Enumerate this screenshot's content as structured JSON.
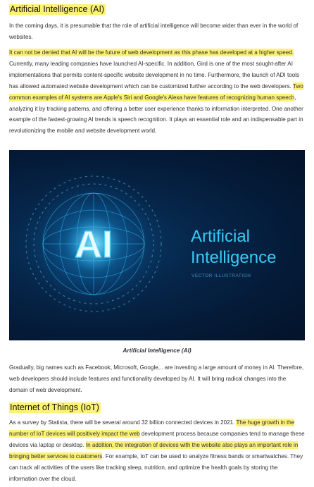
{
  "section1": {
    "heading": "Artificial Intelligence (AI)",
    "p1": "In the coming days, it is presumable that the role of artificial intelligence will become wider than ever in the world of websites.",
    "p2": {
      "h1": "It can not be denied that AI will be the future of web development as this phase has developed at a higher speed.",
      "t1": " Currently, many leading companies have launched AI-specific. In addition, Gird is one of the most sought-after AI implementations that permits content-specific website development in no time. Furthermore, the launch of ADI tools has allowed automated website development which can be customized further according to the web developers. ",
      "h2": "Two common examples of AI systems are Apple's Siri and Google's Alexa have features of recognizing human speech",
      "t2": ", analyzing it by tracking patterns, and offering a better user experience thanks to information interpreted. One another example of the fastest-growing AI trends is speech recognition. It plays an essential role and an indispensable part in revolutionizing the mobile and website development world."
    }
  },
  "image": {
    "mark": "AI",
    "title_line1": "Artificial",
    "title_line2": "Intelligence",
    "subtitle": "VECTOR ILLUSTRATION",
    "caption": "Artificial Intelligence (AI)"
  },
  "p3": "Gradually, big names such as Facebook, Microsoft, Google,.. are investing a large amount of money in AI. Therefore, web developers should include features and functionality developed by AI. It will bring radical changes into the domain of web development.",
  "section2": {
    "heading": "Internet of Things (IoT)",
    "p": {
      "t1": "As a survey by Statista, there will be several around 32 billion connected devices in 2021. ",
      "h1": "The huge growth in the number of IoT devices will positively impact the web",
      "t2": " development process because companies tend to manage these devices via laptop or desktop. ",
      "h2": "In addition, the integration of devices with the website also plays an important role in bringing better services to customers",
      "t3": ". For example, IoT can be used to analyze fitness bands or smartwatches. They can track all activities of the users like tracking sleep, nutrition, and optimize the health goals by storing the information over the cloud."
    }
  },
  "colors": {
    "highlight": "#fdf176",
    "image_bg": "#041a36",
    "glow": "#35c6ff"
  }
}
